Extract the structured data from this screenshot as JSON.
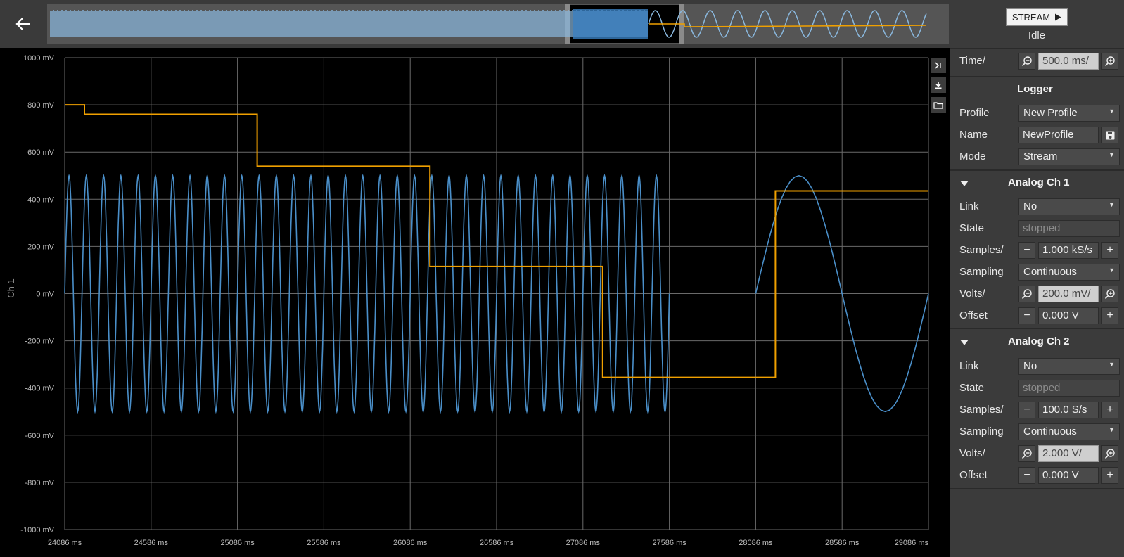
{
  "chart_data": {
    "type": "line",
    "ylabel": "Ch 1",
    "xlim": [
      24086,
      29086
    ],
    "ylim": [
      -1000,
      1000
    ],
    "grid": true,
    "x_ticks": [
      "24086 ms",
      "24586 ms",
      "25086 ms",
      "25586 ms",
      "26086 ms",
      "26586 ms",
      "27086 ms",
      "27586 ms",
      "28086 ms",
      "28586 ms",
      "29086 ms"
    ],
    "y_ticks": [
      "1000 mV",
      "800 mV",
      "600 mV",
      "400 mV",
      "200 mV",
      "0 mV",
      "-200 mV",
      "-400 mV",
      "-600 mV",
      "-800 mV",
      "-1000 mV"
    ],
    "series": [
      {
        "color": "#4a8fc9",
        "segments": [
          {
            "x_start": 24086,
            "x_end": 27586,
            "amplitude_mV": 500,
            "period_ms": 100
          },
          {
            "x_start": 28086,
            "x_end": 29086,
            "amplitude_mV": 500,
            "period_ms": 1000
          }
        ]
      },
      {
        "color": "#f0a000",
        "steps": [
          {
            "x": 24086,
            "y": 800
          },
          {
            "x": 24200,
            "y": 760
          },
          {
            "x": 25200,
            "y": 540
          },
          {
            "x": 26200,
            "y": 115
          },
          {
            "x": 27200,
            "y": -355
          },
          {
            "x": 28200,
            "y": 435
          },
          {
            "x": 29086,
            "y": 435
          }
        ]
      }
    ]
  },
  "toolbar": {
    "stream_label": "STREAM",
    "status": "Idle",
    "time_label": "Time/",
    "time_value": "500.0 ms/"
  },
  "logger": {
    "title": "Logger",
    "profile_label": "Profile",
    "profile_value": "New Profile",
    "name_label": "Name",
    "name_value": "NewProfile",
    "mode_label": "Mode",
    "mode_value": "Stream"
  },
  "ch1": {
    "title": "Analog Ch 1",
    "link_label": "Link",
    "link_value": "No",
    "state_label": "State",
    "state_value": "stopped",
    "samples_label": "Samples/",
    "samples_value": "1.000 kS/s",
    "sampling_label": "Sampling",
    "sampling_value": "Continuous",
    "volts_label": "Volts/",
    "volts_value": "200.0 mV/",
    "offset_label": "Offset",
    "offset_value": "0.000 V"
  },
  "ch2": {
    "title": "Analog Ch 2",
    "link_label": "Link",
    "link_value": "No",
    "state_label": "State",
    "state_value": "stopped",
    "samples_label": "Samples/",
    "samples_value": "100.0 S/s",
    "sampling_label": "Sampling",
    "sampling_value": "Continuous",
    "volts_label": "Volts/",
    "volts_value": "2.000 V/",
    "offset_label": "Offset",
    "offset_value": "0.000 V"
  },
  "colors": {
    "ch1": "#4a8fc9",
    "ch2": "#f0a000",
    "overview_waveform": "#8ab8de",
    "grid": "#6a6a6a"
  },
  "icons": {
    "back": "arrow-left-icon",
    "play": "play-icon",
    "zoom_out": "magnifier-minus-icon",
    "zoom_in": "magnifier-plus-icon",
    "save": "floppy-icon",
    "download": "download-icon",
    "folder": "folder-icon",
    "jump_end": "skip-to-end-icon",
    "collapse": "triangle-down-icon"
  }
}
